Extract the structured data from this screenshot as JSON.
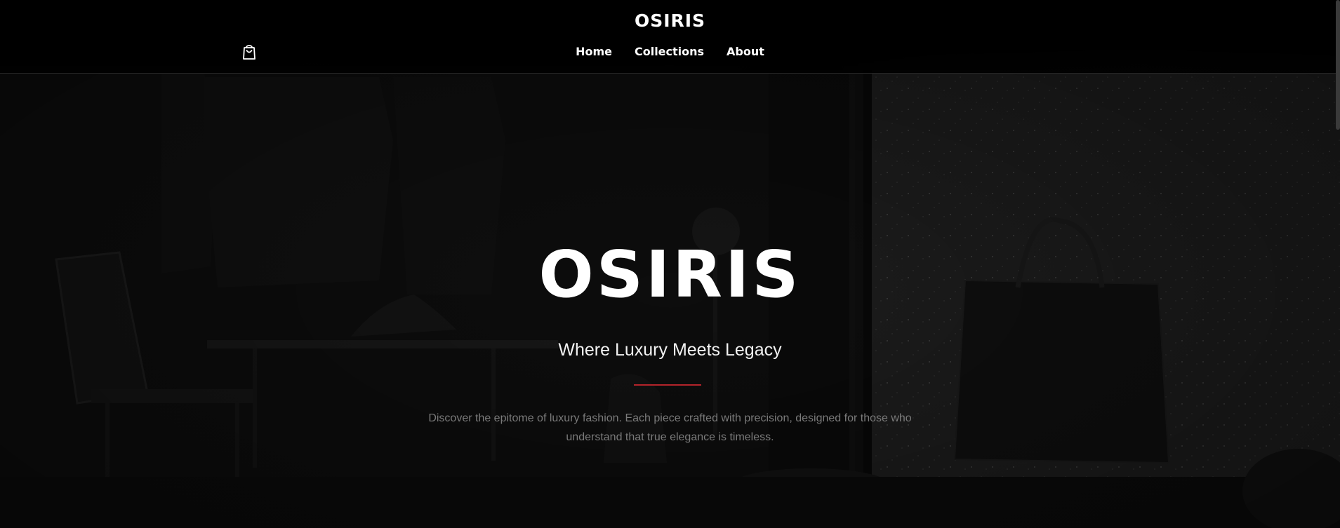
{
  "header": {
    "brand": "OSIRIS",
    "cart_icon": "shopping-bag-icon",
    "nav": [
      {
        "label": "Home"
      },
      {
        "label": "Collections"
      },
      {
        "label": "About"
      }
    ]
  },
  "hero": {
    "title": "OSIRIS",
    "subtitle": "Where Luxury Meets Legacy",
    "description": "Discover the epitome of luxury fashion. Each piece crafted with precision, designed for those who understand that true elegance is timeless.",
    "accent_color": "#b3232a"
  }
}
